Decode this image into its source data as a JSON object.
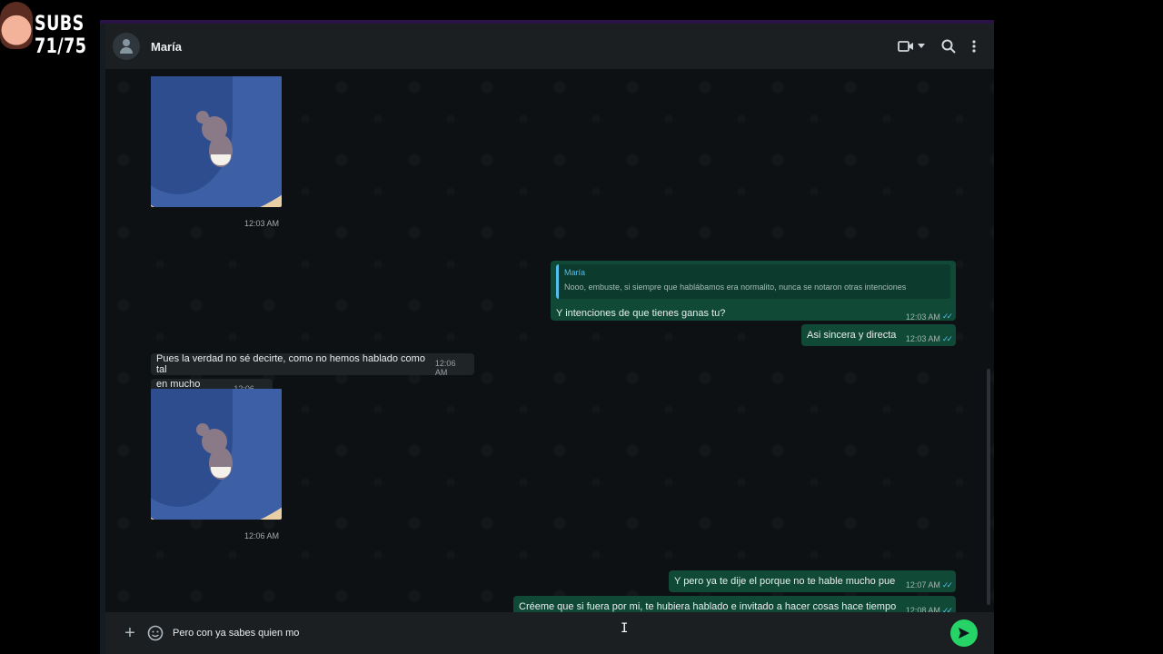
{
  "overlay": {
    "subs_text": "SUBS 71/75"
  },
  "header": {
    "contact_name": "María"
  },
  "icons": {
    "video": "video-call-icon",
    "dropdown": "chevron-down-icon",
    "search": "search-icon",
    "menu": "more-vertical-icon",
    "attach": "plus-icon",
    "sticker": "sticker-icon",
    "send": "send-icon"
  },
  "messages": [
    {
      "type": "image",
      "direction": "in",
      "time": "12:03 AM"
    },
    {
      "type": "reply",
      "direction": "out",
      "quote_author": "María",
      "quote_text": "Nooo, embuste, si siempre que hablábamos era normalito, nunca se notaron otras intenciones",
      "text": "Y intenciones de que tienes ganas tu?",
      "time": "12:03 AM"
    },
    {
      "type": "text",
      "direction": "out",
      "text": "Asi sincera y directa",
      "time": "12:03 AM"
    },
    {
      "type": "text",
      "direction": "in",
      "text": "Pues la verdad no sé decirte, como no hemos hablado como tal",
      "time": "12:06 AM"
    },
    {
      "type": "text",
      "direction": "in",
      "text": "en mucho tiempo",
      "time": "12:06 AM"
    },
    {
      "type": "image",
      "direction": "in",
      "time": "12:06 AM"
    },
    {
      "type": "text",
      "direction": "out",
      "text": "Y pero ya te dije el porque no te hable mucho pue",
      "time": "12:07 AM"
    },
    {
      "type": "text",
      "direction": "out",
      "text": "Créeme que si fuera por mi, te hubiera hablado e invitado a hacer cosas hace tiempo",
      "time": "12:08 AM"
    }
  ],
  "composer": {
    "value": "Pero con ya sabes quien mo"
  },
  "colors": {
    "outgoing_bubble": "#104a37",
    "incoming_bubble": "#1f2427",
    "send_button": "#25d366",
    "read_ticks": "#53bdeb"
  }
}
